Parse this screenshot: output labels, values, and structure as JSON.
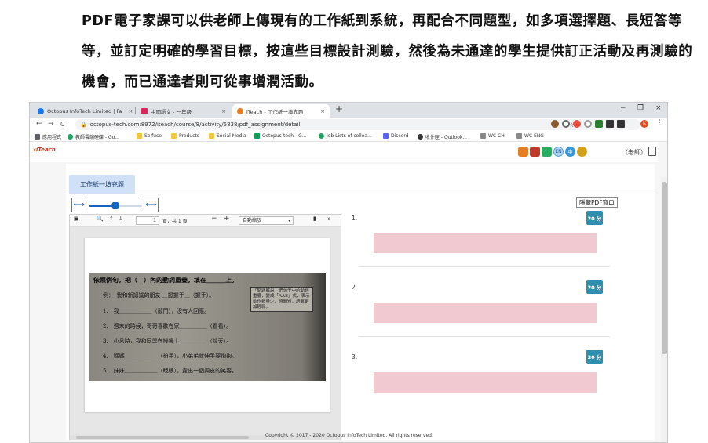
{
  "caption": "PDF電子家課可以供老師上傳現有的工作紙到系統，再配合不同題型，如多項選擇題、長短答等等，並訂定明確的學習目標，按這些目標設計測驗，然後為未通達的學生提供訂正活動及再測驗的機會，而已通達者則可從事增潤活動。",
  "browser": {
    "tabs": [
      {
        "label": "Octopus InfoTech Limited | Fa",
        "icon": "facebook-icon",
        "color": "#1877f2",
        "close": "×"
      },
      {
        "label": "中國語文 - 一年級",
        "icon": "page-icon",
        "color": "#e0245e",
        "close": "×"
      },
      {
        "label": "iTeach - 工作紙一填充題",
        "icon": "iteach-icon",
        "color": "#e67e22",
        "close": "×"
      }
    ],
    "new_tab": "+",
    "window_controls": [
      "−",
      "❐",
      "×"
    ],
    "nav": [
      "←",
      "→",
      "C"
    ],
    "url": "octopus-tech.com:8972/iteach/course/8/activity/5838/pdf_assignment/detail",
    "bookmarks": [
      {
        "label": "應用程式",
        "color": "#5f6368"
      },
      {
        "label": "教師雲端硬碟 - Go...",
        "color": "#1fa463"
      },
      {
        "label": "Selfuse",
        "color": "#f4c542"
      },
      {
        "label": "Products",
        "color": "#f4c542"
      },
      {
        "label": "Social Media",
        "color": "#f4c542"
      },
      {
        "label": "Octopus-tech - G...",
        "color": "#0f9d58"
      },
      {
        "label": "Job Lists of collea...",
        "color": "#1fa463"
      },
      {
        "label": "Discord",
        "color": "#5865f2"
      },
      {
        "label": "收件匣 - Outlook...",
        "color": "#333333"
      },
      {
        "label": "WC CHI",
        "color": "#888888"
      },
      {
        "label": "WC ENG",
        "color": "#888888"
      }
    ]
  },
  "app": {
    "logo_main": "iTeach",
    "logo_prefix": "x",
    "header_icons": [
      {
        "name": "home-icon",
        "color": "#e67e22",
        "text": ""
      },
      {
        "name": "book-icon",
        "color": "#c0392b",
        "text": ""
      },
      {
        "name": "tools-icon",
        "color": "#27ae60",
        "text": ""
      },
      {
        "name": "lang-en-icon",
        "color": "#b0d4f1",
        "text": "EN"
      },
      {
        "name": "lang-zh-icon",
        "color": "#3498db",
        "text": "中"
      },
      {
        "name": "settings-icon",
        "color": "#d4a017",
        "text": ""
      }
    ],
    "user_label": "（老師）",
    "worksheet_tab": "工作紙一填充題",
    "hide_pdf_button": "隱藏PDF窗口",
    "slider_level": 0.5,
    "pdf": {
      "page_input": "1",
      "page_count": "頁，共 1 頁",
      "zoom": "自動縮放",
      "title_line": "依照例句，把（　）內的動詞重疊，填在＿＿＿上。",
      "example": "例：　我和新認識的朋友 ＿握握手＿（握手）。",
      "note": "「問題解說」把句子中的動詞重疊，變成「AAB」式，表示動作數量少、時間短，語氣更加輕鬆。",
      "lines": [
        "1.　我＿＿＿＿＿＿（敲門），沒有人回應。",
        "2.　週末的時候，哥哥喜歡在家＿＿＿＿＿（看看）。",
        "3.　小息時，我和同學在操場上＿＿＿＿＿（談天）。",
        "4.　媽媽＿＿＿＿＿＿（拍手），小弟弟就伸手要抱抱。",
        "5.　妹妹＿＿＿＿＿＿（眨眼），露出一個調皮的笑容。"
      ]
    },
    "questions": [
      {
        "number": "1.",
        "score": "20 分"
      },
      {
        "number": "2.",
        "score": "20 分"
      },
      {
        "number": "3.",
        "score": "20 分"
      }
    ],
    "copyright": "Copyright © 2017 - 2020 Octopus InfoTech Limited. All rights reserved."
  }
}
